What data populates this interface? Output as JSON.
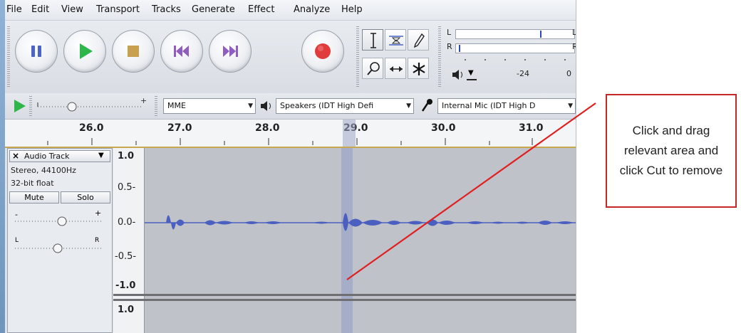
{
  "menu": [
    "File",
    "Edit",
    "View",
    "Transport",
    "Tracks",
    "Generate",
    "Effect",
    "Analyze",
    "Help"
  ],
  "transport": {
    "buttons": [
      {
        "name": "pause-icon",
        "color": "#4a64c8"
      },
      {
        "name": "play-icon",
        "color": "#2fb64a"
      },
      {
        "name": "stop-icon",
        "color": "#c9a050"
      },
      {
        "name": "skip-start-icon",
        "color": "#8f5dbf"
      },
      {
        "name": "skip-end-icon",
        "color": "#8f5dbf"
      },
      {
        "name": "record-icon",
        "color": "#e03c3c"
      }
    ]
  },
  "meter": {
    "left_label": "L",
    "right_label": "R",
    "db_labels": [
      "-24",
      "0"
    ],
    "side_labels": [
      "L",
      "R"
    ]
  },
  "devicebar": {
    "host": "MME",
    "output": "Speakers (IDT High Defi",
    "input": "Internal Mic (IDT High D"
  },
  "ruler": {
    "ticks": [
      "26.0",
      "27.0",
      "28.0",
      "29.0",
      "30.0",
      "31.0"
    ],
    "tick_lead": "?"
  },
  "track": {
    "name": "Audio Track",
    "close_label": "×",
    "format_line1": "Stereo, 44100Hz",
    "format_line2": "32-bit float",
    "mute_label": "Mute",
    "solo_label": "Solo",
    "gain_minus": "-",
    "gain_plus": "+",
    "pan_left": "L",
    "pan_right": "R"
  },
  "vruler": {
    "labels": [
      "1.0",
      "0.5-",
      "0.0-",
      "-0.5-",
      "-1.0",
      "1.0"
    ]
  },
  "annotation": {
    "text": "Click and drag relevant area and click Cut to remove",
    "border_color": "#c62828"
  },
  "colors": {
    "waveform": "#4b5fc0",
    "selection": "#9fa7c9",
    "annotation_line": "#e02020"
  }
}
